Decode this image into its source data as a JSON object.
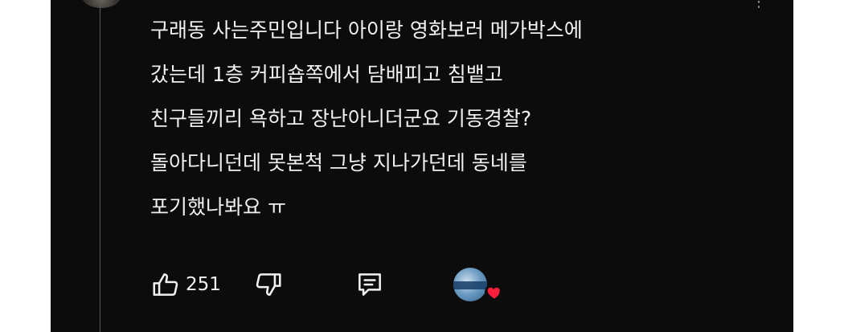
{
  "comment": {
    "lines": [
      "구래동 사는주민입니다 아이랑 영화보러 메가박스에",
      "갔는데 1층 커피숍쪽에서 담배피고 침뱉고",
      "친구들끼리 욕하고 장난아니더군요 기동경찰?",
      "돌아다니던데 못본척 그냥 지나가던데 동네를",
      "포기했나봐요 ㅠ"
    ]
  },
  "actions": {
    "like_count": "251"
  },
  "icons": {
    "like": "thumbs-up-icon",
    "dislike": "thumbs-down-icon",
    "reply": "comment-icon",
    "creator_heart": "heart-icon"
  },
  "colors": {
    "background": "#0c0c0c",
    "text": "#f1f1f1",
    "heart": "#ff1f3d"
  }
}
